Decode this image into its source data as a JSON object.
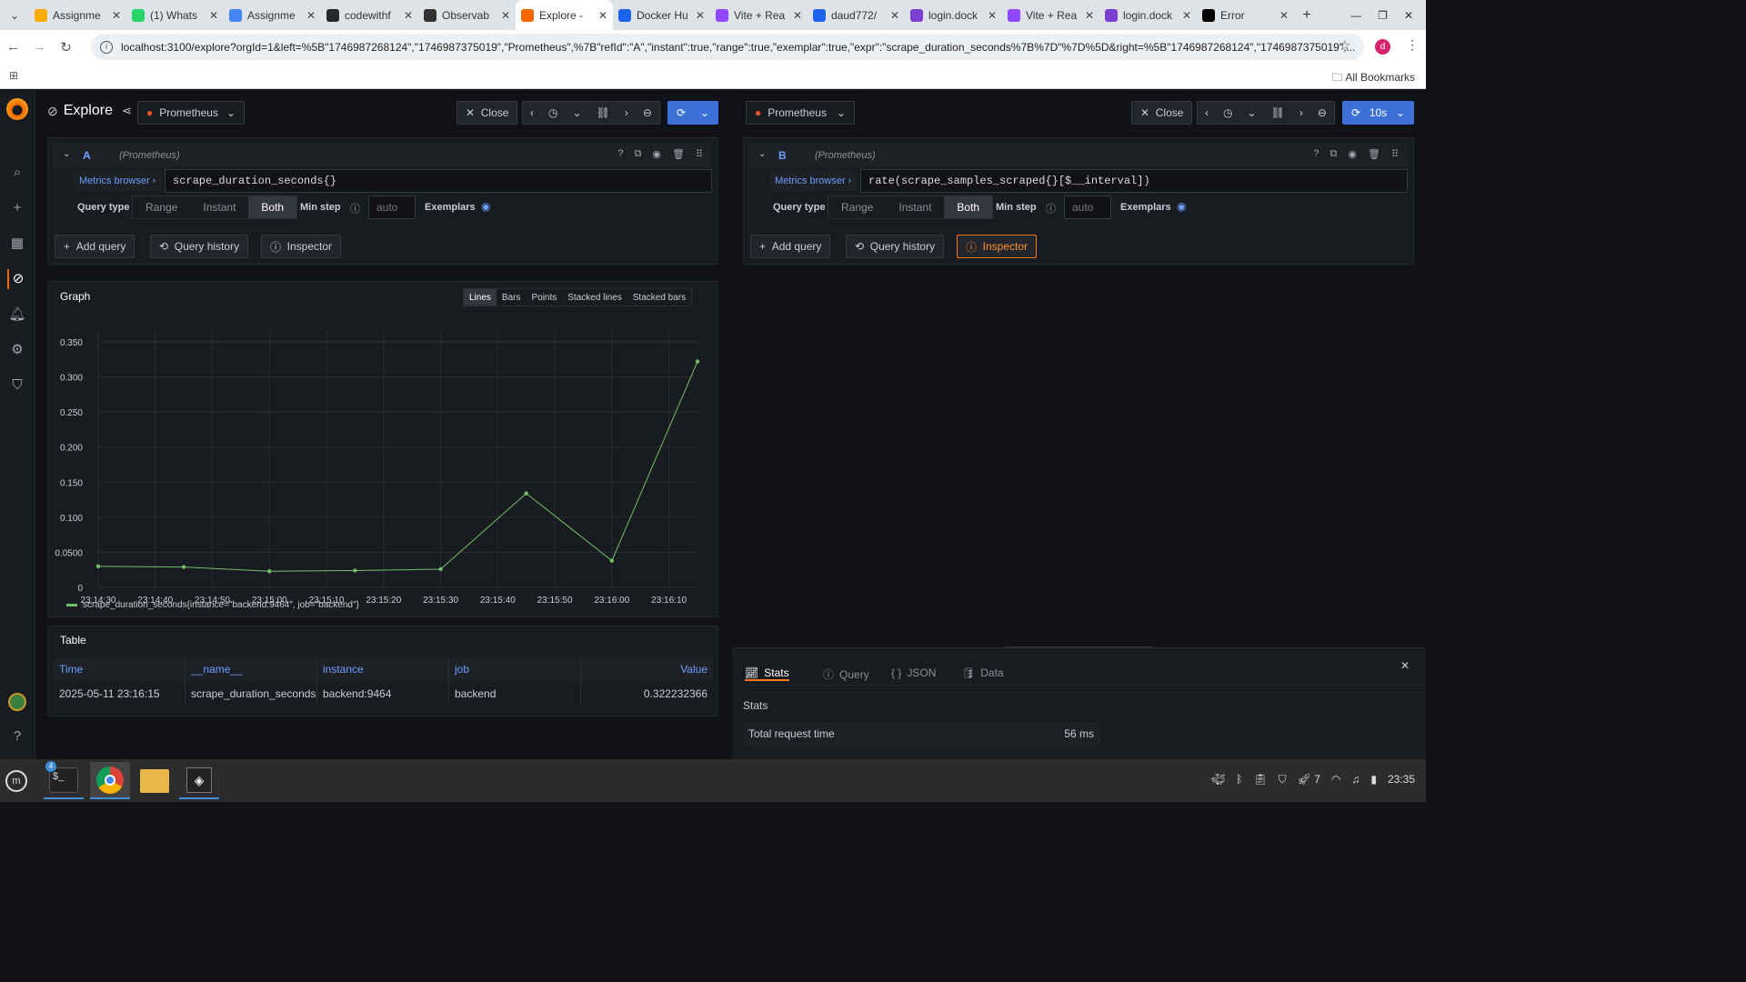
{
  "browser": {
    "tabs": [
      {
        "title": "Assignme",
        "icon": "google-classroom-icon",
        "color": "#f9ab00"
      },
      {
        "title": "(1) Whats",
        "icon": "whatsapp-icon",
        "color": "#25d366"
      },
      {
        "title": "Assignme",
        "icon": "google-docs-icon",
        "color": "#4285f4"
      },
      {
        "title": "codewithf",
        "icon": "github-icon",
        "color": "#24292e"
      },
      {
        "title": "Observab",
        "icon": "circle-logo-icon",
        "color": "#333333"
      },
      {
        "title": "Explore - ",
        "icon": "grafana-icon",
        "color": "#f46800"
      },
      {
        "title": "Docker Hu",
        "icon": "docker-hub-icon",
        "color": "#1d63ed"
      },
      {
        "title": "Vite + Rea",
        "icon": "vite-icon",
        "color": "#8f47ff"
      },
      {
        "title": "daud772/",
        "icon": "docker-hub-icon",
        "color": "#1d63ed"
      },
      {
        "title": "login.dock",
        "icon": "docker-icon",
        "color": "#7a3fd0"
      },
      {
        "title": "Vite + Rea",
        "icon": "vite-icon",
        "color": "#8f47ff"
      },
      {
        "title": "login.dock",
        "icon": "docker-icon",
        "color": "#7a3fd0"
      },
      {
        "title": "Error",
        "icon": "vercel-icon",
        "color": "#000000"
      }
    ],
    "active_tab": 5,
    "url": "localhost:3100/explore?orgId=1&left=%5B\"1746987268124\",\"1746987375019\",\"Prometheus\",%7B\"refId\":\"A\",\"instant\":true,\"range\":true,\"exemplar\":true,\"expr\":\"scrape_duration_seconds%7B%7D\"%7D%5D&right=%5B\"1746987268124\",\"1746987375019\",...",
    "profile_initial": "d",
    "all_bookmarks": "All Bookmarks"
  },
  "explore": {
    "title": "Explore",
    "left": {
      "datasource": "Prometheus",
      "close": "Close",
      "query": {
        "ref": "A",
        "ds_hint": "(Prometheus)",
        "metrics_browser": "Metrics browser",
        "expr": "scrape_duration_seconds{}",
        "query_type_label": "Query type",
        "query_types": [
          "Range",
          "Instant",
          "Both"
        ],
        "selected_type": "Both",
        "min_step_label": "Min step",
        "min_step_placeholder": "auto",
        "exemplars_label": "Exemplars"
      },
      "add_query": "Add query",
      "query_history": "Query history",
      "inspector": "Inspector"
    },
    "right": {
      "datasource": "Prometheus",
      "close": "Close",
      "refresh_interval": "10s",
      "query": {
        "ref": "B",
        "ds_hint": "(Prometheus)",
        "metrics_browser": "Metrics browser",
        "expr": "rate(scrape_samples_scraped{}[$__interval])",
        "query_type_label": "Query type",
        "query_types": [
          "Range",
          "Instant",
          "Both"
        ],
        "selected_type": "Both",
        "min_step_label": "Min step",
        "min_step_placeholder": "auto",
        "exemplars_label": "Exemplars"
      },
      "add_query": "Add query",
      "query_history": "Query history",
      "inspector": "Inspector"
    },
    "graph": {
      "title": "Graph",
      "modes": [
        "Lines",
        "Bars",
        "Points",
        "Stacked lines",
        "Stacked bars"
      ],
      "selected_mode": "Lines",
      "legend": "scrape_duration_seconds{instance=\"backend:9464\", job=\"backend\"}",
      "line_color": "#73bf69"
    },
    "table": {
      "title": "Table",
      "headers": [
        "Time",
        "__name__",
        "instance",
        "job",
        "Value"
      ],
      "rows": [
        [
          "2025-05-11 23:16:15",
          "scrape_duration_seconds",
          "backend:9464",
          "backend",
          "0.322232366"
        ]
      ]
    },
    "inspector_panel": {
      "tabs": [
        "Stats",
        "Query",
        "JSON",
        "Data"
      ],
      "selected": "Stats",
      "heading": "Stats",
      "rows": [
        {
          "label": "Total request time",
          "value": "56 ms"
        }
      ]
    }
  },
  "chart_data": {
    "type": "line",
    "x": [
      "23:14:30",
      "23:14:45",
      "23:15:00",
      "23:15:15",
      "23:15:30",
      "23:15:45",
      "23:16:00",
      "23:16:15"
    ],
    "x_ticks": [
      "23:14:30",
      "23:14:40",
      "23:14:50",
      "23:15:00",
      "23:15:10",
      "23:15:20",
      "23:15:30",
      "23:15:40",
      "23:15:50",
      "23:16:00",
      "23:16:10"
    ],
    "series": [
      {
        "name": "scrape_duration_seconds{instance=\"backend:9464\", job=\"backend\"}",
        "values": [
          0.03,
          0.029,
          0.023,
          0.024,
          0.026,
          0.134,
          0.038,
          0.322
        ]
      }
    ],
    "y_ticks": [
      "0",
      "0.0500",
      "0.100",
      "0.150",
      "0.200",
      "0.250",
      "0.300",
      "0.350"
    ],
    "ylim": [
      0,
      0.35
    ],
    "grid": true,
    "legend": "bottom-left"
  },
  "taskbar": {
    "badge": "4",
    "clock": "23:35",
    "notif_count": "7"
  }
}
